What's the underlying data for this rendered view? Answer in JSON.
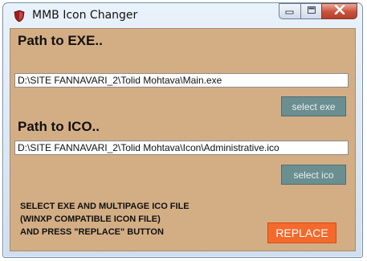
{
  "window": {
    "title": "MMB Icon Changer",
    "app_icon": "shield-app-icon",
    "controls": [
      "minimize-icon",
      "maximize-icon",
      "close-icon"
    ]
  },
  "exe": {
    "label": "Path to EXE..",
    "path": "D:\\SITE FANNAVARI_2\\Tolid Mohtava\\Main.exe",
    "button": "select exe"
  },
  "ico": {
    "label": "Path to ICO..",
    "path": "D:\\SITE FANNAVARI_2\\Tolid Mohtava\\Icon\\Administrative.ico",
    "button": "select ico"
  },
  "instructions": [
    "SELECT EXE AND MULTIPAGE ICO FILE",
    "(WINXP COMPATIBLE ICON FILE)",
    "AND PRESS \"REPLACE\" BUTTON"
  ],
  "replace_button": "REPLACE",
  "colors": {
    "panel": "#d3ae85",
    "select_button": "#6b8e91",
    "replace_button": "#f46a2c"
  }
}
